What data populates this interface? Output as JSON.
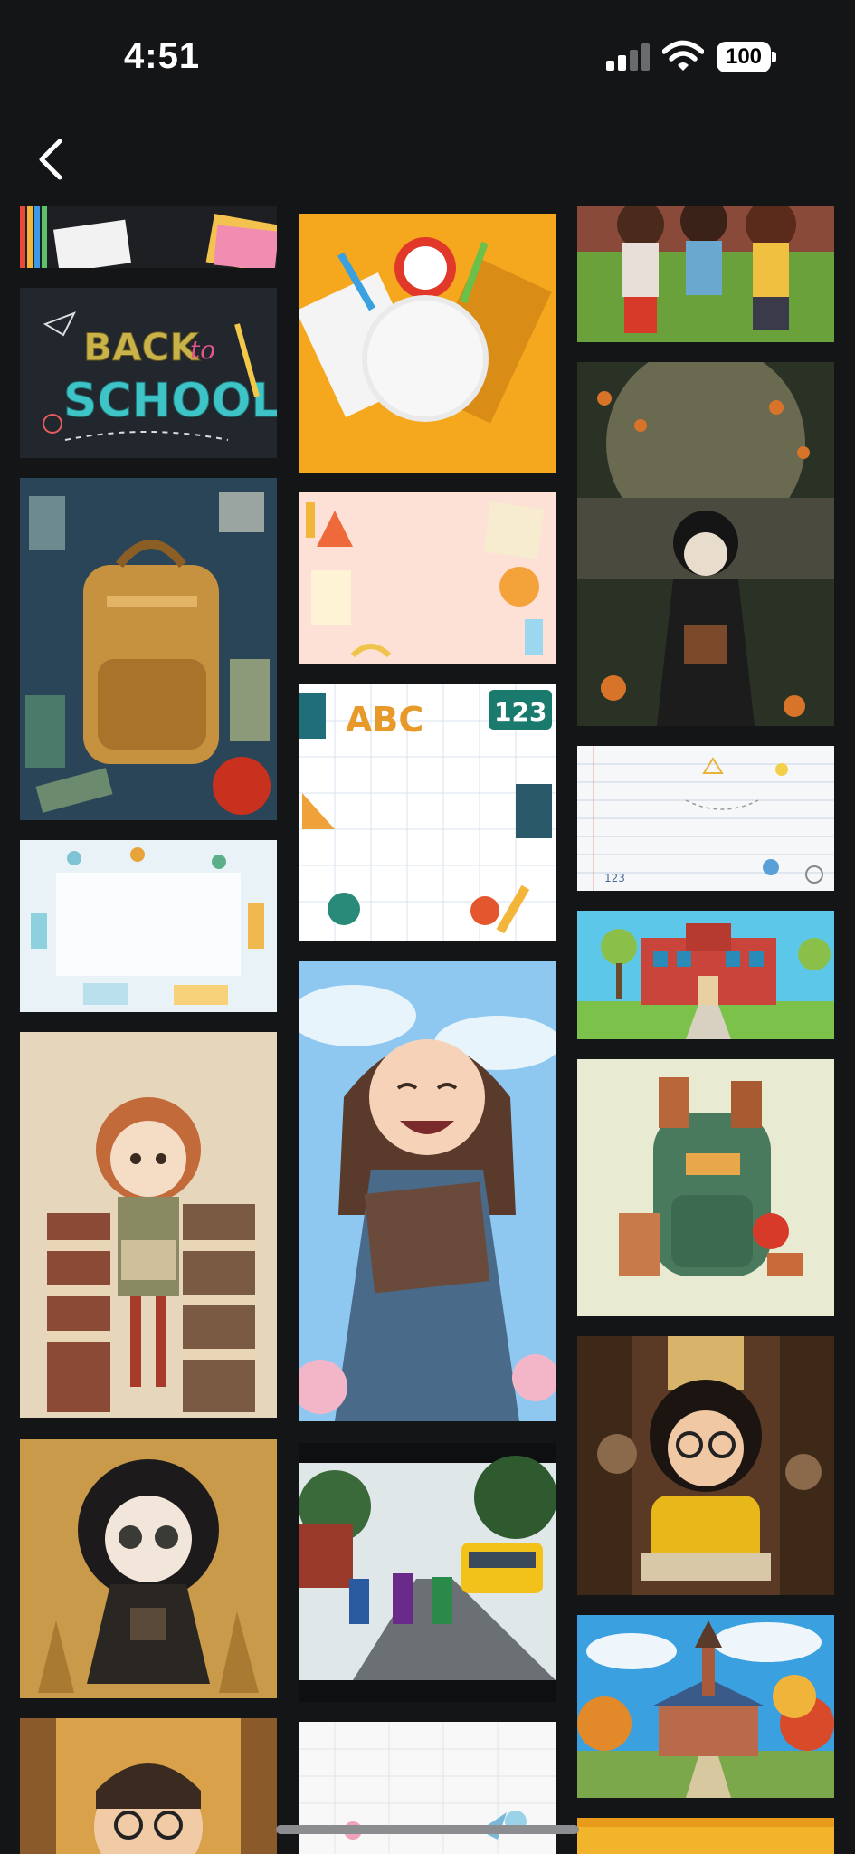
{
  "status_bar": {
    "time": "4:51",
    "battery": "100",
    "icons": [
      "cellular-signal-icon",
      "wifi-icon",
      "battery-icon"
    ]
  },
  "navigation": {
    "back_icon": "chevron-left-icon"
  },
  "gallery": {
    "columns": [
      [
        {
          "name": "image-pencils-notebook",
          "description_colors": [
            "#1c1d20",
            "#e14d72"
          ]
        },
        {
          "name": "image-back-to-school-chalkboard",
          "text_line1": "BACK",
          "text_to": "to",
          "text_line2": "SCHOOL"
        },
        {
          "name": "image-backpack-collage"
        },
        {
          "name": "image-school-doodle-frame"
        },
        {
          "name": "image-girl-on-books"
        },
        {
          "name": "image-curly-hair-girl"
        },
        {
          "name": "image-boy-glasses-forest"
        }
      ],
      [
        {
          "name": "image-school-supplies-clock"
        },
        {
          "name": "image-pink-supplies-frame"
        },
        {
          "name": "image-abc-123-frame",
          "text_abc": "ABC",
          "text_123": "123"
        },
        {
          "name": "image-happy-girl-reading"
        },
        {
          "name": "image-kids-school-bus"
        },
        {
          "name": "image-grid-paper-doodles"
        }
      ],
      [
        {
          "name": "image-three-girls"
        },
        {
          "name": "image-girl-apple-village"
        },
        {
          "name": "image-lined-paper-doodles",
          "text_123": "123"
        },
        {
          "name": "image-school-building"
        },
        {
          "name": "image-green-backpack"
        },
        {
          "name": "image-girl-glasses-library"
        },
        {
          "name": "image-church-autumn"
        },
        {
          "name": "image-yellow-strip"
        }
      ]
    ]
  }
}
